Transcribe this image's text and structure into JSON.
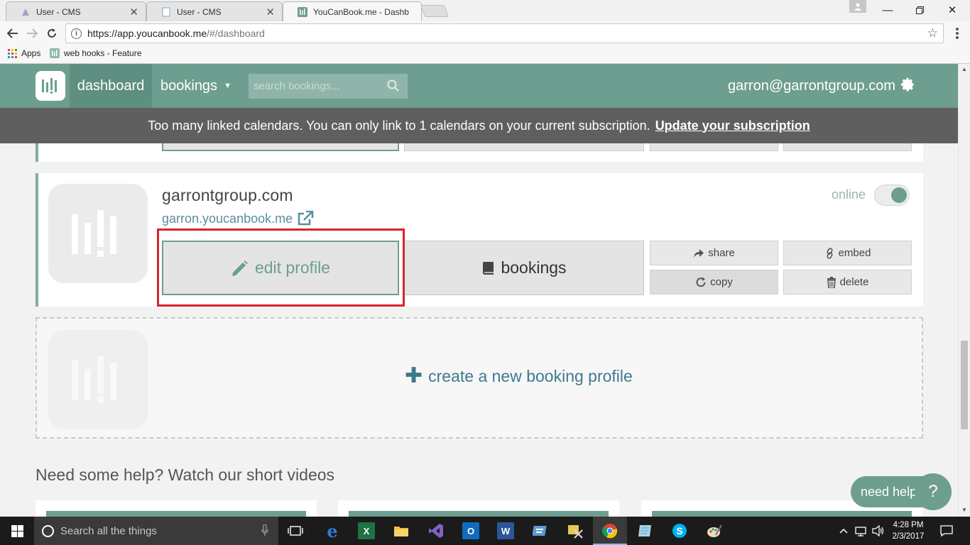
{
  "browser": {
    "tabs": [
      {
        "title": "User - CMS",
        "active": false
      },
      {
        "title": "User - CMS",
        "active": false
      },
      {
        "title": "YouCanBook.me - Dashb",
        "active": true
      }
    ],
    "url_host": "https://app.youcanbook.me",
    "url_path": "/#/dashboard",
    "bookmarks": {
      "apps": "Apps",
      "webhooks": "web hooks - Feature"
    }
  },
  "app": {
    "brand_color": "#6d9e8f",
    "nav": {
      "dashboard": "dashboard",
      "bookings": "bookings"
    },
    "search_placeholder": "search bookings...",
    "user_email": "garron@garrontgroup.com",
    "banner": {
      "message": "Too many linked calendars. You can only link to 1 calendars on your current subscription.",
      "link": "Update your subscription"
    },
    "profile": {
      "name": "garrontgroup.com",
      "url": "garron.youcanbook.me",
      "status": "online",
      "edit_label": "edit profile",
      "bookings_label": "bookings",
      "share_label": "share",
      "embed_label": "embed",
      "copy_label": "copy",
      "delete_label": "delete"
    },
    "create_label": "create a new booking profile",
    "help_title": "Need some help? Watch our short videos",
    "need_help": "need help",
    "need_help_icon": "?"
  },
  "taskbar": {
    "search_placeholder": "Search all the things",
    "time": "4:28 PM",
    "date": "2/3/2017"
  }
}
